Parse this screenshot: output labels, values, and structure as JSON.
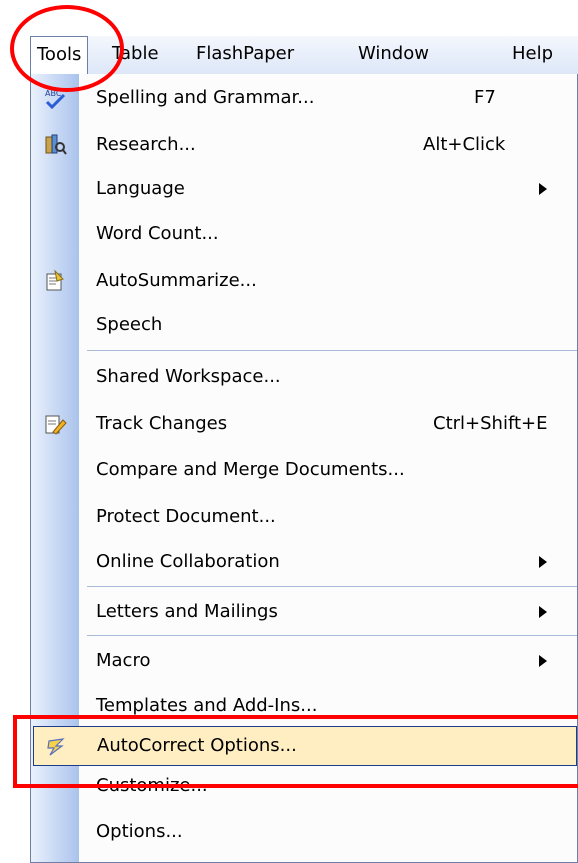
{
  "menubar": {
    "items": [
      {
        "label": "Tools",
        "mnemonic": "T"
      },
      {
        "label": "Table",
        "mnemonic": "a"
      },
      {
        "label": "FlashPaper",
        "mnemonic": "P"
      },
      {
        "label": "Window",
        "mnemonic": "W"
      },
      {
        "label": "Help",
        "mnemonic": "H"
      }
    ]
  },
  "menu": {
    "items": [
      {
        "label": "Spelling and Grammar...",
        "shortcut": "F7",
        "icon": "spelling-icon",
        "submenu": false
      },
      {
        "label": "Research...",
        "shortcut": "Alt+Click",
        "icon": "research-icon",
        "submenu": false
      },
      {
        "label": "Language",
        "shortcut": "",
        "icon": "",
        "submenu": true
      },
      {
        "label": "Word Count...",
        "shortcut": "",
        "icon": "",
        "submenu": false
      },
      {
        "label": "AutoSummarize...",
        "shortcut": "",
        "icon": "autosummarize-icon",
        "submenu": false
      },
      {
        "label": "Speech",
        "shortcut": "",
        "icon": "",
        "submenu": false
      },
      {
        "label": "Shared Workspace...",
        "shortcut": "",
        "icon": "",
        "submenu": false
      },
      {
        "label": "Track Changes",
        "shortcut": "Ctrl+Shift+E",
        "icon": "track-changes-icon",
        "submenu": false
      },
      {
        "label": "Compare and Merge Documents...",
        "shortcut": "",
        "icon": "",
        "submenu": false
      },
      {
        "label": "Protect Document...",
        "shortcut": "",
        "icon": "",
        "submenu": false
      },
      {
        "label": "Online Collaboration",
        "shortcut": "",
        "icon": "",
        "submenu": true
      },
      {
        "label": "Letters and Mailings",
        "shortcut": "",
        "icon": "",
        "submenu": true
      },
      {
        "label": "Macro",
        "shortcut": "",
        "icon": "",
        "submenu": true
      },
      {
        "label": "Templates and Add-Ins...",
        "shortcut": "",
        "icon": "",
        "submenu": false
      },
      {
        "label": "AutoCorrect Options...",
        "shortcut": "",
        "icon": "autocorrect-icon",
        "submenu": false,
        "highlighted": true
      },
      {
        "label": "Customize...",
        "shortcut": "",
        "icon": "",
        "submenu": false
      },
      {
        "label": "Options...",
        "shortcut": "",
        "icon": "",
        "submenu": false
      }
    ]
  },
  "colors": {
    "annotation": "#ff0000",
    "highlight_fill": "#ffeec2",
    "highlight_border": "#1b3d8a",
    "gutter_light": "#eaf1fd",
    "gutter_dark": "#aac3ec",
    "menubar_bg": "#dde7f8"
  }
}
